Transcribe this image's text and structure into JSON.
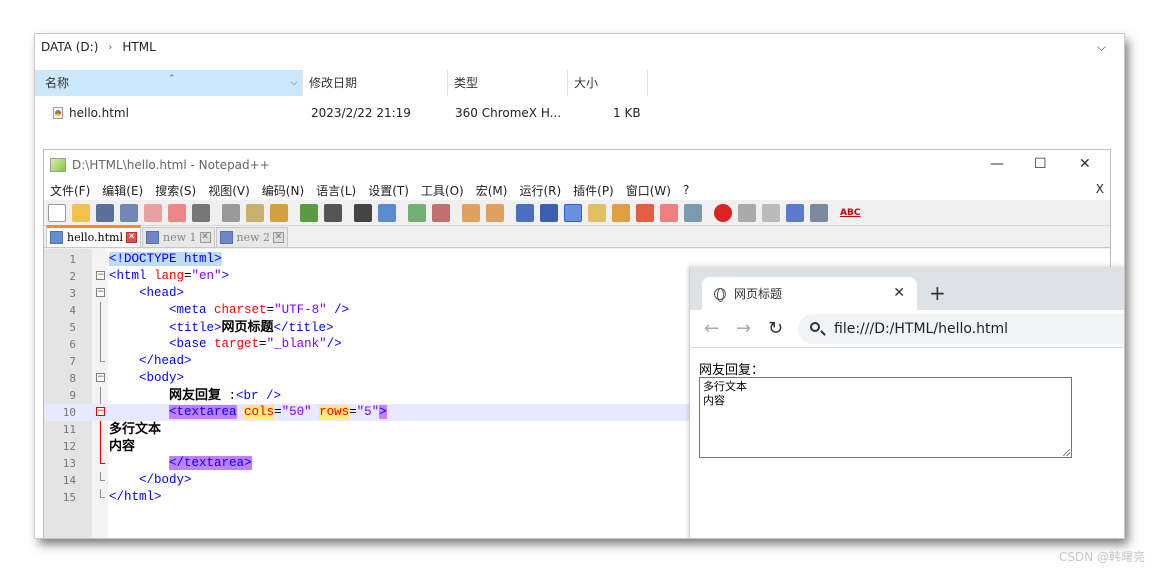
{
  "explorer": {
    "breadcrumb": [
      "DATA (D:)",
      "HTML"
    ],
    "columns": {
      "name": "名称",
      "date": "修改日期",
      "type": "类型",
      "size": "大小"
    },
    "file": {
      "name": "hello.html",
      "date": "2023/2/22 21:19",
      "type": "360 ChromeX H...",
      "size": "1 KB"
    }
  },
  "npp": {
    "title": "D:\\HTML\\hello.html - Notepad++",
    "menu": [
      "文件(F)",
      "编辑(E)",
      "搜索(S)",
      "视图(V)",
      "编码(N)",
      "语言(L)",
      "设置(T)",
      "工具(O)",
      "宏(M)",
      "运行(R)",
      "插件(P)",
      "窗口(W)",
      "?"
    ],
    "menu_close": "X",
    "tabs": [
      "hello.html",
      "new 1",
      "new 2"
    ],
    "spellcheck_icon": "ABC",
    "lines": [
      "1",
      "2",
      "3",
      "4",
      "5",
      "6",
      "7",
      "8",
      "9",
      "10",
      "11",
      "12",
      "13",
      "14",
      "15"
    ],
    "code": {
      "l1": "<!DOCTYPE html>",
      "l2_tag": "<html ",
      "l2_attr": "lang",
      "l2_eq": "=",
      "l2_val": "\"en\"",
      "l2_end": ">",
      "l3": "<head>",
      "l4_tag": "<meta ",
      "l4_attr": "charset",
      "l4_eq": "=",
      "l4_val": "\"UTF-8\"",
      "l4_end": " />",
      "l5_open": "<title>",
      "l5_text": "网页标题",
      "l5_close": "</title>",
      "l6_tag": "<base ",
      "l6_attr": "target",
      "l6_eq": "=",
      "l6_val": "\"_blank\"",
      "l6_end": "/>",
      "l7": "</head>",
      "l8": "<body>",
      "l9_text": "网友回复",
      "l9_colon": " :",
      "l9_tag": "<br />",
      "l10_tag": "<textarea",
      "l10_a1": "cols",
      "l10_v1": "\"50\"",
      "l10_a2": "rows",
      "l10_v2": "\"5\"",
      "l10_end": ">",
      "l11": "多行文本",
      "l12": "内容",
      "l13": "</textarea>",
      "l14": "</body>",
      "l15": "</html>"
    }
  },
  "browser": {
    "tab_title": "网页标题",
    "url": "file:///D:/HTML/hello.html",
    "label": "网友回复：",
    "textarea": "多行文本\n内容"
  },
  "watermark": "CSDN @韩曙亮"
}
